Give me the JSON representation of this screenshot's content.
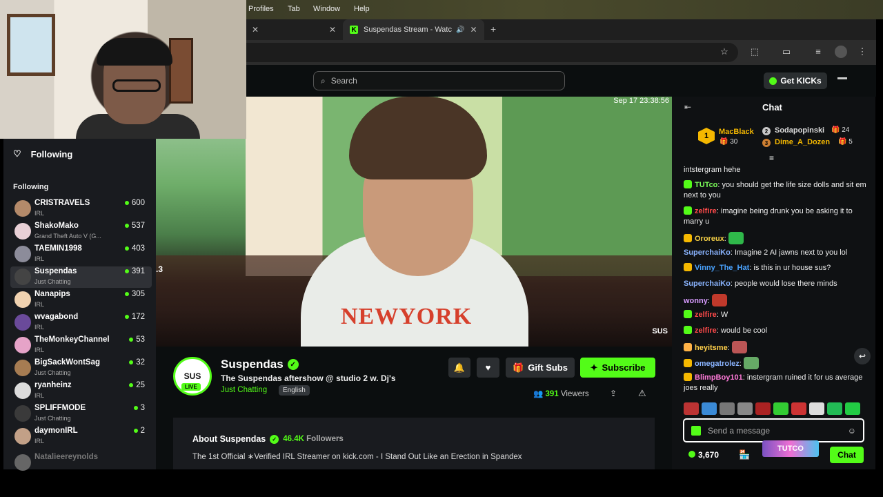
{
  "menubar": {
    "items": [
      "Profiles",
      "Tab",
      "Window",
      "Help"
    ]
  },
  "tabs": [
    {
      "label": "",
      "close": "✕"
    },
    {
      "label": "Suspendas Stream - Watc",
      "close": "✕"
    }
  ],
  "new_tab": "+",
  "kick_header": {
    "search_placeholder": "Search",
    "get_kicks": "Get KICKs"
  },
  "sidebar": {
    "header": "Following",
    "section_label": "Following",
    "items": [
      {
        "name": "CRISTRAVELS",
        "category": "IRL",
        "viewers": "600",
        "avatar": "#b48a6a"
      },
      {
        "name": "ShakoMako",
        "category": "Grand Theft Auto V (G...",
        "viewers": "537",
        "avatar": "#e8d0d6"
      },
      {
        "name": "TAEMIN1998",
        "category": "IRL",
        "viewers": "403",
        "avatar": "#8c8c9a"
      },
      {
        "name": "Suspendas",
        "category": "Just Chatting",
        "viewers": "391",
        "avatar": "#444"
      },
      {
        "name": "Nanapips",
        "category": "IRL",
        "viewers": "305",
        "avatar": "#f0d2b0"
      },
      {
        "name": "wvagabond",
        "category": "IRL",
        "viewers": "172",
        "avatar": "#6a4a9a"
      },
      {
        "name": "TheMonkeyChannel",
        "category": "IRL",
        "viewers": "53",
        "avatar": "#e6a3c8"
      },
      {
        "name": "BigSackWontSag",
        "category": "Just Chatting",
        "viewers": "32",
        "avatar": "#a67c52"
      },
      {
        "name": "ryanheinz",
        "category": "IRL",
        "viewers": "25",
        "avatar": "#dcdcdc"
      },
      {
        "name": "SPLIFFMODE",
        "category": "Just Chatting",
        "viewers": "3",
        "avatar": "#3a3a3a"
      },
      {
        "name": "daymonIRL",
        "category": "IRL",
        "viewers": "2",
        "avatar": "#c2a087"
      },
      {
        "name": "Natalieereynolds",
        "category": "",
        "viewers": "",
        "avatar": "#666"
      }
    ]
  },
  "video": {
    "timestamp": "Sep 17  23:38:56",
    "left_marker": ".3",
    "watermark": "SUS",
    "shirt_text": "NEWYORK"
  },
  "channel": {
    "avatar_text": "SUS",
    "live_badge": "LIVE",
    "name": "Suspendas",
    "title": "The Suspendas aftershow  @ studio 2 w. Dj's",
    "category": "Just Chatting",
    "language": "English",
    "gift_subs": "Gift Subs",
    "subscribe": "Subscribe",
    "viewers_count": "391",
    "viewers_label": "Viewers"
  },
  "about": {
    "title": "About Suspendas",
    "followers_count": "46.4K",
    "followers_label": "Followers",
    "description": "The 1st Official ∗Verified IRL Streamer on kick.com - I Stand Out Like an Erection in Spandex"
  },
  "chat": {
    "title": "Chat",
    "leaderboard": [
      {
        "rank": "1",
        "name": "MacBlack",
        "value": "30",
        "color": "#f5b800"
      },
      {
        "rank": "2",
        "name": "Sodapopinski",
        "value": "24",
        "color": "#c8c8c8"
      },
      {
        "rank": "3",
        "name": "Dime_A_Dozen",
        "value": "5",
        "color": "#cd7f32"
      }
    ],
    "messages": [
      {
        "user": "",
        "color": "#eee",
        "text": "intstergram hehe"
      },
      {
        "user": "TUTco",
        "color": "#7cff5a",
        "text": "you should get the life size dolls and sit em next to you"
      },
      {
        "user": "zelfire",
        "color": "#ff4a4a",
        "text": "imagine being drunk you be asking it to marry u"
      },
      {
        "user": "Ororeux",
        "color": "#f5d046",
        "text": ""
      },
      {
        "user": "SuperchaiKo",
        "color": "#8ab4ff",
        "text": "Imagine 2 AI jawns next to you lol"
      },
      {
        "user": "Vinny_The_Hat",
        "color": "#4aa3ff",
        "text": "is this in ur house sus?"
      },
      {
        "user": "SuperchaiKo",
        "color": "#8ab4ff",
        "text": "people would lose there minds"
      },
      {
        "user": "wonny",
        "color": "#d79bff",
        "text": ""
      },
      {
        "user": "zelfire",
        "color": "#ff4a4a",
        "text": "W"
      },
      {
        "user": "zelfire",
        "color": "#ff4a4a",
        "text": "would be cool"
      },
      {
        "user": "heyitsme",
        "color": "#ffd04a",
        "text": ""
      },
      {
        "user": "omegatrolez",
        "color": "#8ab4ff",
        "text": ""
      },
      {
        "user": "BlimpBoy101",
        "color": "#ff7ad9",
        "text": "instergram ruined it for us average joes really"
      }
    ],
    "input_placeholder": "Send a message",
    "kicks_balance": "3,670",
    "send_button": "Chat",
    "tutco_banner": "TUTCO"
  }
}
